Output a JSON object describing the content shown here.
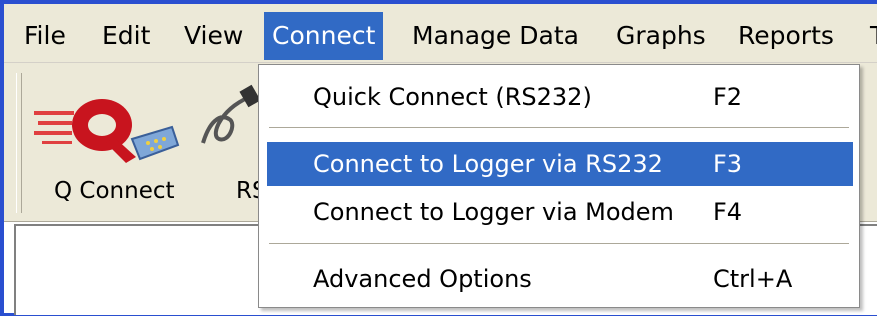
{
  "menubar": {
    "items": [
      {
        "label": "File"
      },
      {
        "label": "Edit"
      },
      {
        "label": "View"
      },
      {
        "label": "Connect"
      },
      {
        "label": "Manage Data"
      },
      {
        "label": "Graphs"
      },
      {
        "label": "Reports"
      },
      {
        "label": "T"
      }
    ]
  },
  "toolbar": {
    "buttons": [
      {
        "label": "Q Connect",
        "icon": "quick-connect-icon"
      },
      {
        "label": "RS",
        "icon": "serial-cable-icon"
      }
    ]
  },
  "connect_menu": {
    "items": [
      {
        "label": "Quick Connect (RS232)",
        "shortcut": "F2"
      },
      {
        "label": "Connect to Logger via RS232",
        "shortcut": "F3"
      },
      {
        "label": "Connect to Logger via Modem",
        "shortcut": "F4"
      },
      {
        "label": "Advanced Options",
        "shortcut": "Ctrl+A"
      }
    ],
    "highlighted_index": 1
  },
  "colors": {
    "highlight": "#316ac5",
    "chrome": "#ece9d8",
    "frame": "#2a4fd0"
  }
}
